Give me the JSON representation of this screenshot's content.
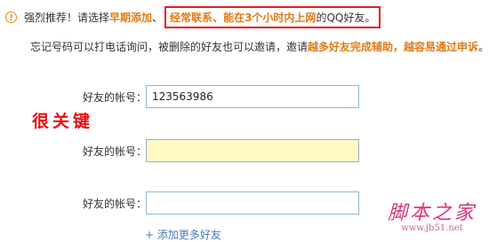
{
  "notice": {
    "icon": "warning-icon",
    "lead": "强烈推荐！请选择",
    "recommend_1": "早期添加",
    "sep_1": "、",
    "callout": {
      "item_1": "经常联系",
      "sep": "、",
      "item_2": "能在3个小时内上网",
      "tail": "的QQ好友。"
    }
  },
  "hint": {
    "text": "忘记号码可以打电话询问，被删除的好友也可以邀请，邀请",
    "emphasis_1": "越多好友完成辅助",
    "sep": "，",
    "emphasis_2": "越容易通过申诉",
    "end": "。"
  },
  "annotation": "很关键",
  "friends": {
    "label": "好友的帐号：",
    "rows": [
      {
        "value": "123563986"
      },
      {
        "value": ""
      },
      {
        "value": ""
      }
    ],
    "add_more": "+ 添加更多好友"
  },
  "watermark": {
    "title": "脚本之家",
    "url": "www.jb51.net"
  }
}
